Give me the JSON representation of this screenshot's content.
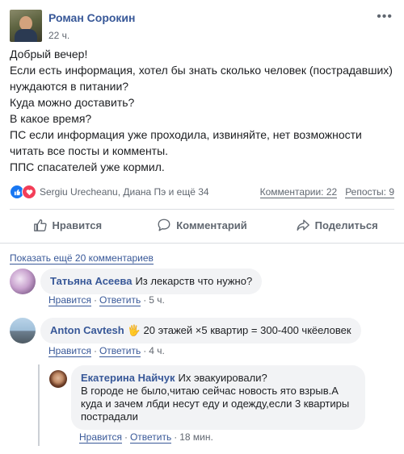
{
  "post": {
    "author": "Роман Сорокин",
    "time": "22 ч.",
    "more_icon": "ellipsis-icon",
    "lines": [
      "Добрый вечер!",
      "Если есть информация, хотел бы знать сколько человек (пострадавших)",
      "нуждаются в питании?",
      "Куда можно доставить?",
      "В какое время?",
      "ПС если информация уже проходила, извиняйте, нет возможности",
      "читать все посты и комменты.",
      "ППС спасателей уже кормил."
    ],
    "reactions_text": "Sergiu Urecheanu, Диана Пэ и ещё 34",
    "comments_count": "Комментарии: 22",
    "shares_count": "Репосты: 9"
  },
  "actions": {
    "like": "Нравится",
    "comment": "Комментарий",
    "share": "Поделиться"
  },
  "comments": {
    "show_more": "Показать ещё 20 комментариев",
    "items": [
      {
        "name": "Татьяна Асеева",
        "text": "Из лекарств что нужно?",
        "like": "Нравится",
        "reply": "Ответить",
        "time": "5 ч."
      },
      {
        "name": "Anton Cavtesh",
        "text": "🖐 20 этажей ×5 квартир = 300-400 чкёеловек",
        "like": "Нравится",
        "reply": "Ответить",
        "time": "4 ч."
      }
    ],
    "reply": {
      "name": "Екатерина Найчук",
      "first": "Их эвакуировали?",
      "lines": [
        "В городе не было,читаю сейчас новость ято взрыв.А",
        "куда и зачем лбди несут еду и одежду,если 3 квартиры",
        "пострадали"
      ],
      "like": "Нравится",
      "reply": "Ответить",
      "time": "18 мин."
    }
  },
  "colors": {
    "link": "#385898",
    "meta": "#616770",
    "bubble": "#f2f3f5",
    "like_blue": "#1877f2",
    "love_red": "#f33e58"
  }
}
